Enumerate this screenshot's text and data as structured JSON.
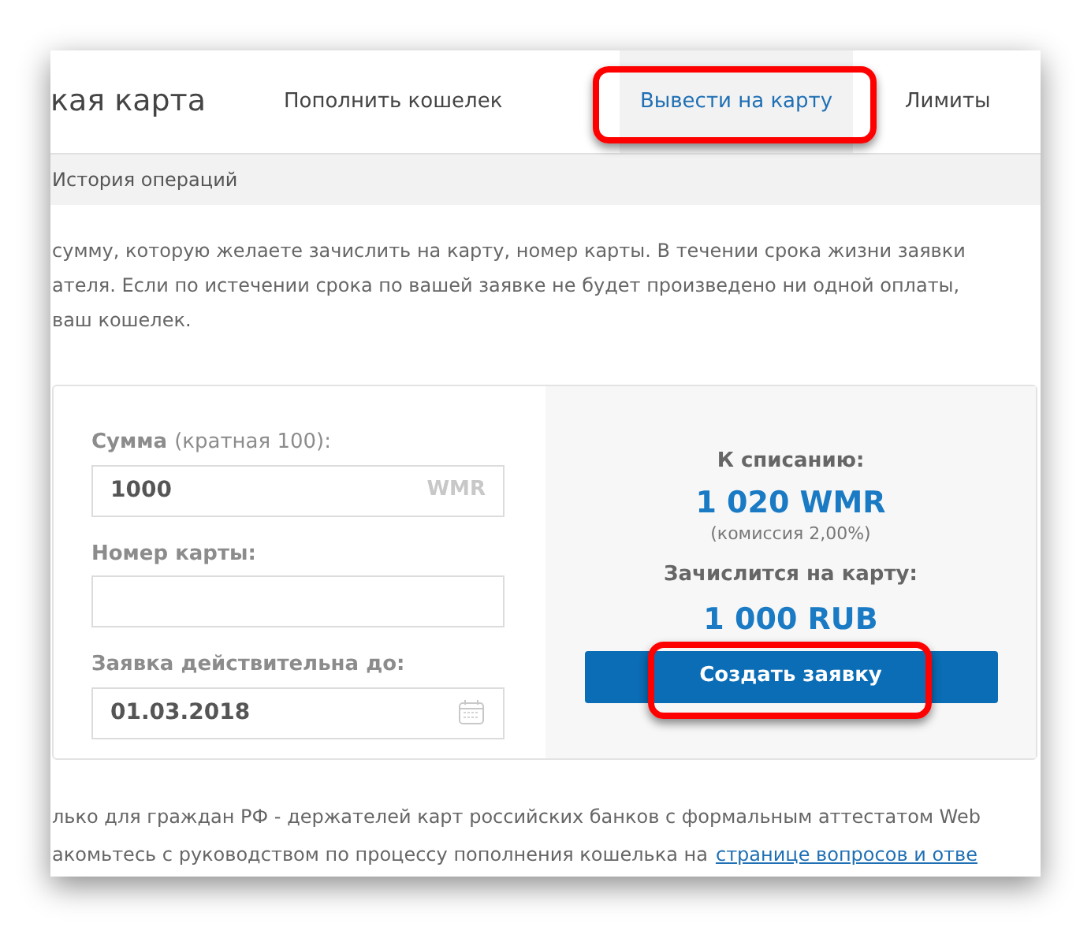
{
  "header": {
    "title": "кая карта",
    "tabs": [
      {
        "label": "Пополнить кошелек",
        "selected": false,
        "highlighted": false
      },
      {
        "label": "Вывести на карту",
        "selected": true,
        "highlighted": true
      },
      {
        "label": "Лимиты",
        "selected": false,
        "highlighted": false
      }
    ]
  },
  "subnav": {
    "items": [
      "История операций"
    ]
  },
  "intro_lines": [
    "сумму, которую желаете зачислить на карту, номер карты. В течении срока жизни заявки",
    "ателя. Если по истечении срока по вашей заявке не будет произведено ни одной оплаты,",
    "ваш кошелек."
  ],
  "form": {
    "fields": [
      {
        "label": "Сумма",
        "hint": "(кратная 100):",
        "value": "1000",
        "suffix": "WMR",
        "kind": "amount"
      },
      {
        "label": "Номер карты:",
        "kind": "text"
      },
      {
        "label": "Заявка действительна до:",
        "value": "01.03.2018",
        "kind": "date"
      }
    ]
  },
  "summary": {
    "debit_label": "К списанию:",
    "debit_value": "1 020 WMR",
    "commission": "(комиссия 2,00%)",
    "credit_label": "Зачислится на карту:",
    "credit_value": "1 000 RUB",
    "button": {
      "label": "Создать заявку",
      "highlighted": true
    }
  },
  "footer": {
    "line_1": "лько для граждан РФ - держателей карт российских банков с формальным аттестатом Web",
    "line_2": "акомьтесь с руководством по процессу пополнения кошелька на",
    "link": "странице вопросов и отве"
  }
}
